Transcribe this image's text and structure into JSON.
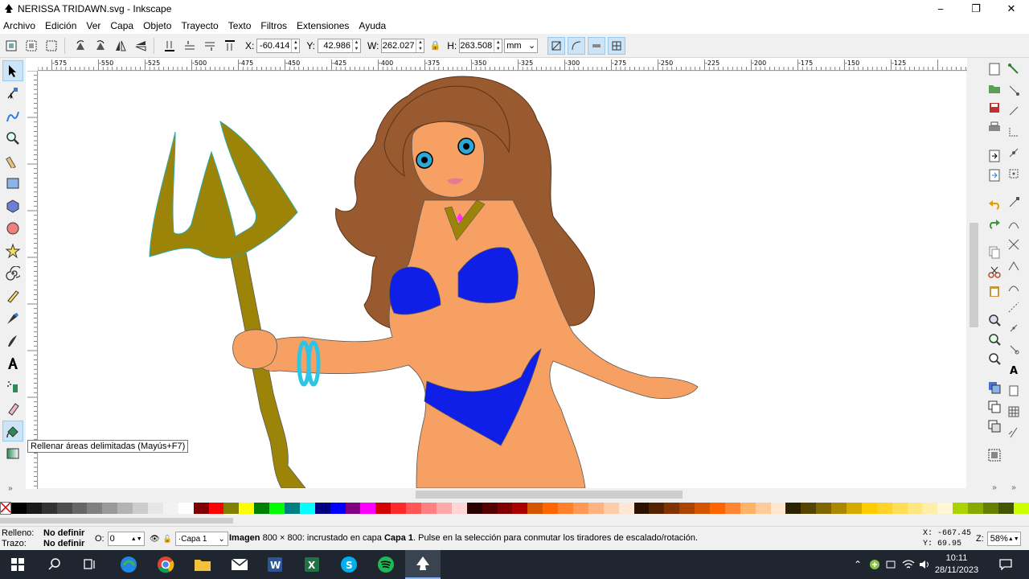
{
  "window": {
    "title": "NERISSA TRIDAWN.svg - Inkscape",
    "minimize": "−",
    "maximize": "❐",
    "close": "✕"
  },
  "menu": [
    "Archivo",
    "Edición",
    "Ver",
    "Capa",
    "Objeto",
    "Trayecto",
    "Texto",
    "Filtros",
    "Extensiones",
    "Ayuda"
  ],
  "toolbar": {
    "x_label": "X:",
    "x_value": "-60.414",
    "y_label": "Y:",
    "y_value": "42.986",
    "w_label": "W:",
    "w_value": "262.027",
    "h_label": "H:",
    "h_value": "263.508",
    "unit": "mm"
  },
  "hruler_labels": [
    "-575",
    "-550",
    "-525",
    "-500",
    "-475",
    "-450",
    "-425",
    "-400",
    "-375",
    "-350",
    "-325",
    "-300",
    "-275",
    "-250",
    "-225",
    "-200",
    "-175",
    "-150",
    "-125"
  ],
  "tooltip": "Rellenar áreas delimitadas (Mayús+F7)",
  "status": {
    "fill_label": "Relleno:",
    "fill_value": "No definir",
    "stroke_label": "Trazo:",
    "stroke_value": "No definir",
    "opacity_label": "O:",
    "opacity_value": "0",
    "layer": "·Capa 1",
    "msg_type": "Imagen",
    "msg_part1": " 800 × 800: incrustado en capa ",
    "msg_layer": "Capa 1",
    "msg_part2": ". Pulse en la selección para conmutar los tiradores de escalado/rotación.",
    "cursor_x": "X: -667.45",
    "cursor_y": "Y:   69.95",
    "zoom_label": "Z:",
    "zoom_value": "58%"
  },
  "palette": [
    "#000000",
    "#1a1a1a",
    "#333333",
    "#4d4d4d",
    "#666666",
    "#808080",
    "#999999",
    "#b3b3b3",
    "#cccccc",
    "#e6e6e6",
    "#f2f2f2",
    "#ffffff",
    "#800000",
    "#ff0000",
    "#808000",
    "#ffff00",
    "#008000",
    "#00ff00",
    "#008080",
    "#00ffff",
    "#000080",
    "#0000ff",
    "#800080",
    "#ff00ff",
    "#d40000",
    "#ff2a2a",
    "#ff5555",
    "#ff8080",
    "#ffaaaa",
    "#ffd5d5",
    "#2b0000",
    "#550000",
    "#800000",
    "#aa0000",
    "#d45500",
    "#ff6600",
    "#ff7f2a",
    "#ff9955",
    "#ffb380",
    "#ffccaa",
    "#ffe6d5",
    "#2b1100",
    "#552200",
    "#803300",
    "#aa4400",
    "#d45500",
    "#ff6600",
    "#ff8533",
    "#ffb366",
    "#ffcc99",
    "#ffe6cc",
    "#2b2200",
    "#554400",
    "#806600",
    "#aa8800",
    "#d4aa00",
    "#ffcc00",
    "#ffd42a",
    "#ffdd55",
    "#ffe680",
    "#ffeeaa",
    "#fff6d5",
    "#aad400",
    "#88aa00",
    "#668000",
    "#445500",
    "#ccff00"
  ],
  "clock": {
    "time": "10:11",
    "date": "28/11/2023"
  },
  "colors": {
    "hair": "#9a5a30",
    "skin": "#f7a063",
    "bikini": "#0f1fe8",
    "trident": "#9c8409",
    "bracelet": "#2ec5e5",
    "eye": "#2aa8d8"
  }
}
